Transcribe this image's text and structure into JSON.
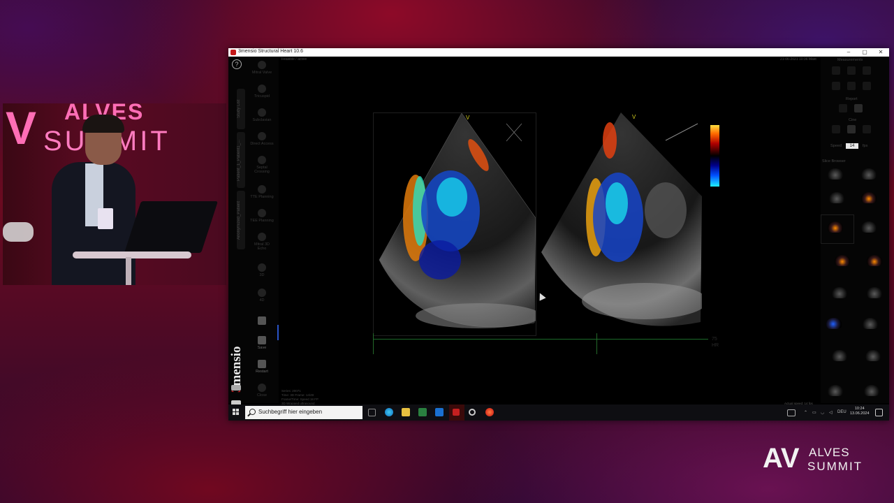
{
  "event": {
    "logo_alves": "ALVES",
    "logo_summit": "SUMMIT",
    "logo_v": "V",
    "corner_av": "AV",
    "corner_alves": "ALVES",
    "corner_summit": "SUMMIT"
  },
  "window": {
    "title": "3mensio Structural Heart 10.6",
    "minimize": "–",
    "maximize": "▢",
    "close": "✕"
  },
  "left_panel": {
    "help": "?",
    "vertical_tabs": [
      "Study List",
      "Patient_1_Patient1_...",
      "Anonymized_Patient"
    ],
    "tools": [
      "Mitral Valve",
      "Tricuspid",
      "Subclavian",
      "Direct Access",
      "Septal Crossing",
      "TTE Planning",
      "TEE Planning",
      "Mitral 3D Echo",
      "3D",
      "4D",
      "",
      "Save",
      "Restart",
      "Close"
    ],
    "brand_prefix": "3",
    "brand_name": "mensio"
  },
  "viewport": {
    "status": "Feasible / active",
    "date": "21-06-2021 10:36 Mast",
    "view1_marker": "V",
    "view2_marker": "V",
    "hr_line1": "75",
    "hr_line2": "HR",
    "footer_lines": [
      "Series: 20071",
      "Time: 3D Frame: 14/49",
      "Frame/Time: Speed 18 FP",
      "3D Wrapped ultrasound"
    ],
    "actual_speed": "Actual speed: 14 fps"
  },
  "right_panel": {
    "measurements": "Measurements",
    "report": "Report",
    "cine": "Cine",
    "speed_label": "Speed",
    "speed_value": "14",
    "fps_label": "fps",
    "slice_browser": "Slice Browser"
  },
  "taskbar": {
    "search_placeholder": "Suchbegriff hier eingeben",
    "lang": "DEU",
    "time": "10:24",
    "date": "13.06.2024"
  },
  "colors": {
    "brand_red": "#d2262a",
    "taskbar": "#0e0e12",
    "frame_marker": "#d6d020"
  }
}
